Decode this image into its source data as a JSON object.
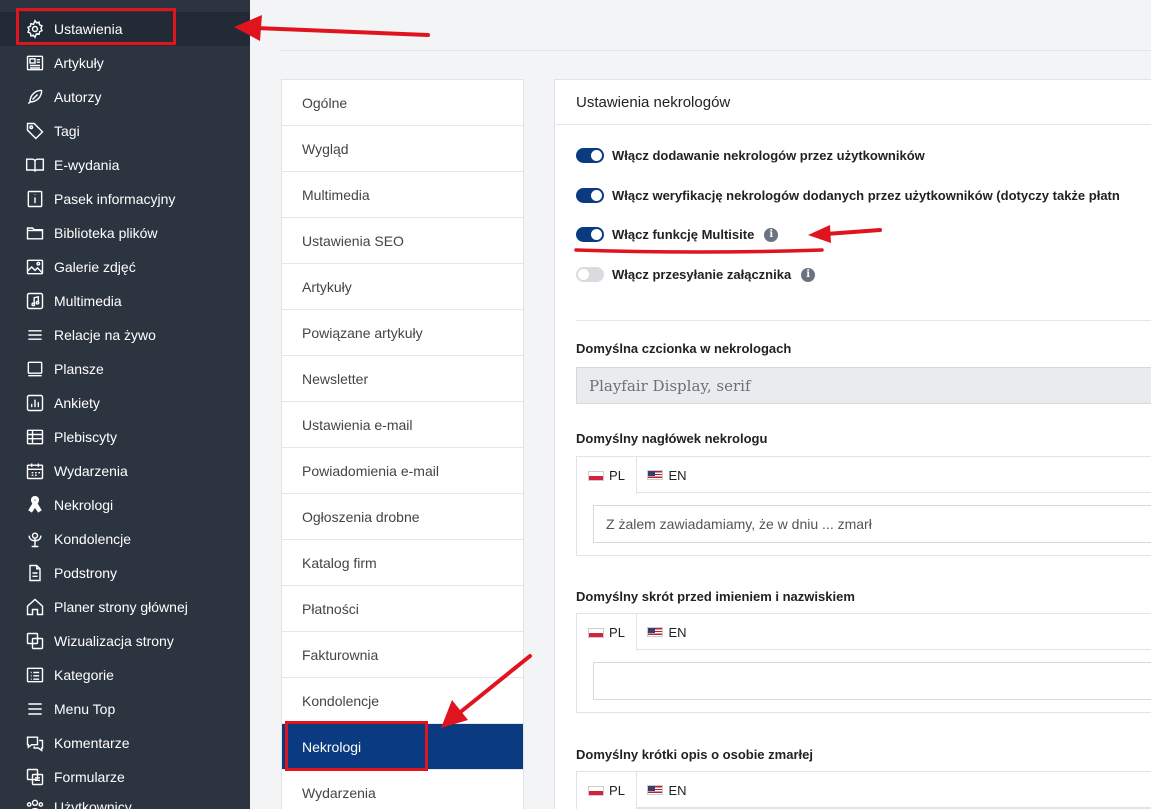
{
  "sidebar": {
    "items": [
      {
        "label": "Ustawienia",
        "icon": "gear-icon"
      },
      {
        "label": "Artykuły",
        "icon": "newspaper-icon"
      },
      {
        "label": "Autorzy",
        "icon": "feather-icon"
      },
      {
        "label": "Tagi",
        "icon": "tag-icon"
      },
      {
        "label": "E-wydania",
        "icon": "book-icon"
      },
      {
        "label": "Pasek informacyjny",
        "icon": "info-square-icon"
      },
      {
        "label": "Biblioteka plików",
        "icon": "folder-icon"
      },
      {
        "label": "Galerie zdjęć",
        "icon": "image-icon"
      },
      {
        "label": "Multimedia",
        "icon": "music-icon"
      },
      {
        "label": "Relacje na żywo",
        "icon": "lines-icon"
      },
      {
        "label": "Plansze",
        "icon": "board-icon"
      },
      {
        "label": "Ankiety",
        "icon": "chart-icon"
      },
      {
        "label": "Plebiscyty",
        "icon": "poll-icon"
      },
      {
        "label": "Wydarzenia",
        "icon": "calendar-icon"
      },
      {
        "label": "Nekrologi",
        "icon": "ribbon-icon"
      },
      {
        "label": "Kondolencje",
        "icon": "flower-icon"
      },
      {
        "label": "Podstrony",
        "icon": "file-icon"
      },
      {
        "label": "Planer strony głównej",
        "icon": "home-icon"
      },
      {
        "label": "Wizualizacja strony",
        "icon": "layers-icon"
      },
      {
        "label": "Kategorie",
        "icon": "list-icon"
      },
      {
        "label": "Menu Top",
        "icon": "menu-icon"
      },
      {
        "label": "Komentarze",
        "icon": "comments-icon"
      },
      {
        "label": "Formularze",
        "icon": "forms-icon"
      },
      {
        "label": "Użytkownicy",
        "icon": "users-icon"
      }
    ]
  },
  "subnav": {
    "items": [
      "Ogólne",
      "Wygląd",
      "Multimedia",
      "Ustawienia SEO",
      "Artykuły",
      "Powiązane artykuły",
      "Newsletter",
      "Ustawienia e-mail",
      "Powiadomienia e-mail",
      "Ogłoszenia drobne",
      "Katalog firm",
      "Płatności",
      "Fakturownia",
      "Kondolencje",
      "Nekrologi",
      "Wydarzenia"
    ],
    "active": "Nekrologi"
  },
  "panel": {
    "title": "Ustawienia nekrologów",
    "toggles": [
      {
        "label": "Włącz dodawanie nekrologów przez użytkowników",
        "on": true,
        "info": false
      },
      {
        "label": "Włącz weryfikację nekrologów dodanych przez użytkowników (dotyczy także płatn",
        "on": true,
        "info": false
      },
      {
        "label": "Włącz funkcję Multisite",
        "on": true,
        "info": true
      },
      {
        "label": "Włącz przesyłanie załącznika",
        "on": false,
        "info": true
      }
    ],
    "font_label": "Domyślna czcionka w nekrologach",
    "font_value": "Playfair Display, serif",
    "header_label": "Domyślny nagłówek nekrologu",
    "header_value": "Z żalem zawiadamiamy, że w dniu ... zmarł",
    "prefix_label": "Domyślny skrót przed imieniem i nazwiskiem",
    "prefix_value": "",
    "desc_label": "Domyślny krótki opis o osobie zmarłej",
    "lang_pl": "PL",
    "lang_en": "EN",
    "info_glyph": "i"
  },
  "colors": {
    "accent": "#0a3a80",
    "sidebar_bg": "#2c3440",
    "annotation": "#e0141e"
  }
}
